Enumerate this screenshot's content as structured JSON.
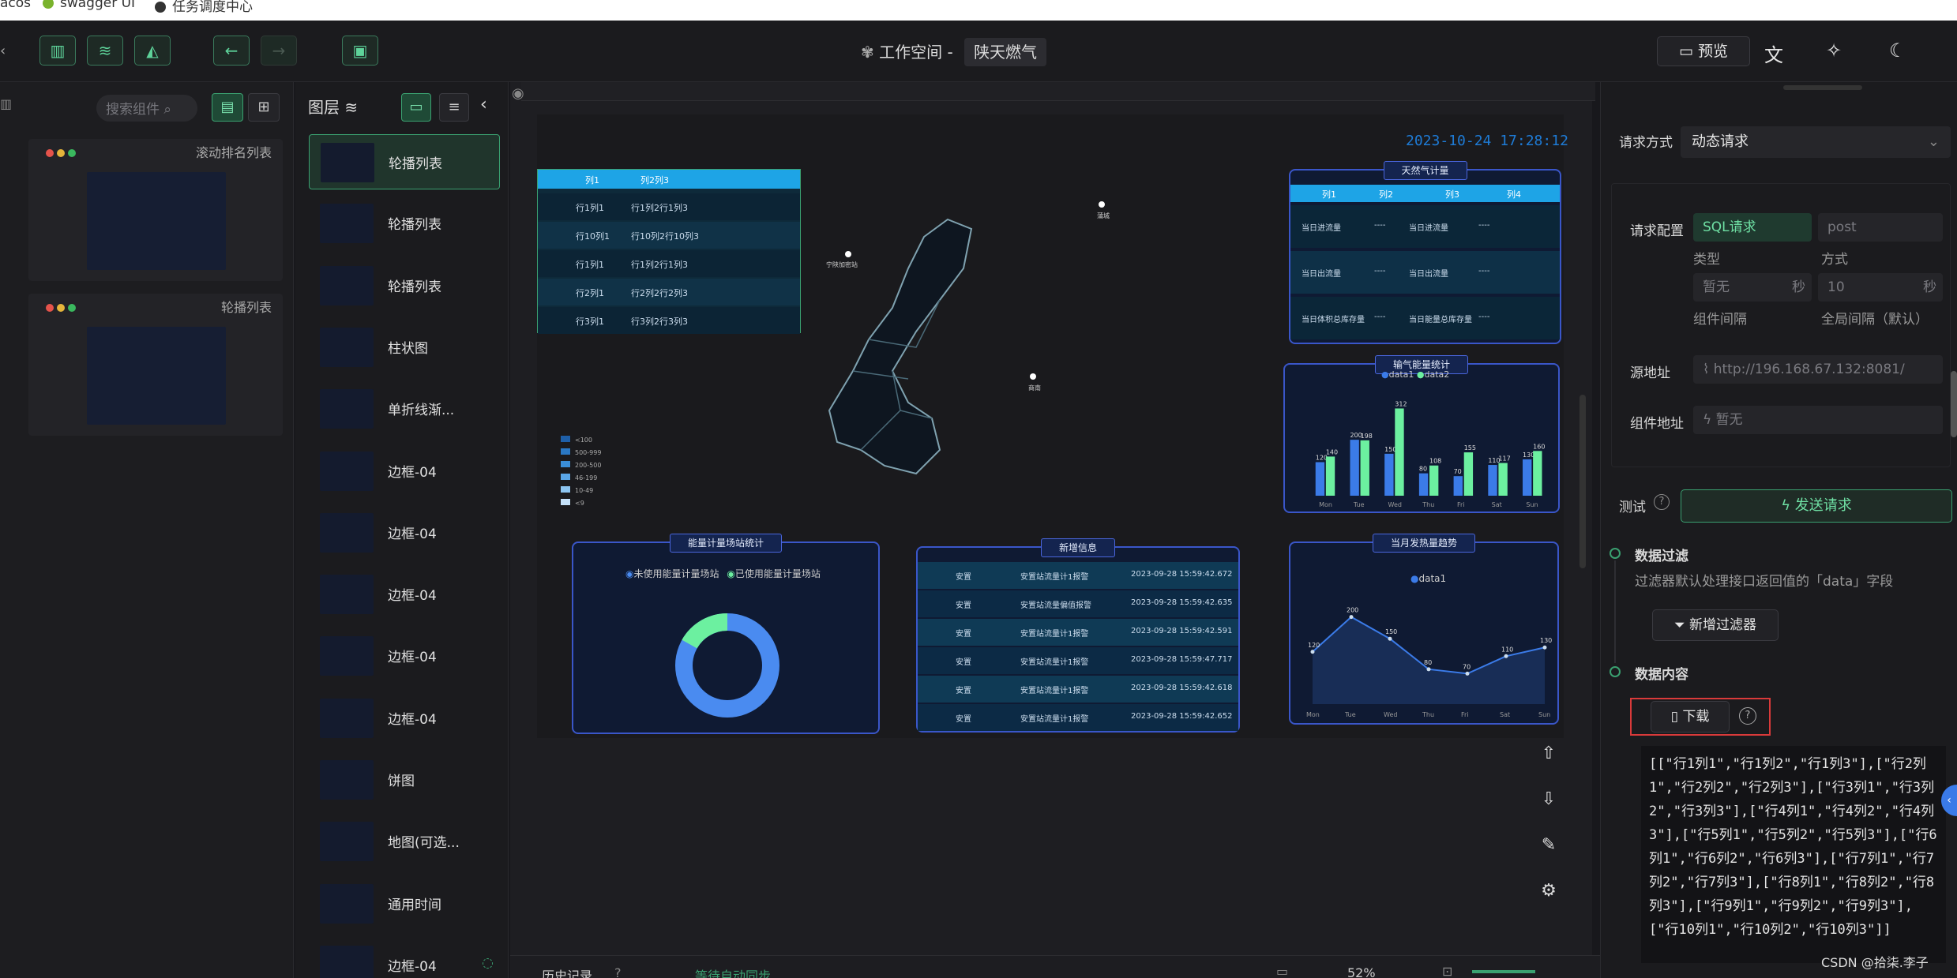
{
  "bookmarks": [
    "acos",
    "swagger UI",
    "任务调度中心"
  ],
  "topbar": {
    "workspace_label": "工作空间 -",
    "project_name": "陕天燃气",
    "preview_label": "预览"
  },
  "components": {
    "search_placeholder": "搜索组件",
    "cards": [
      "滚动排名列表",
      "轮播列表"
    ]
  },
  "layers": {
    "title": "图层",
    "items": [
      "轮播列表",
      "轮播列表",
      "轮播列表",
      "柱状图",
      "单折线渐...",
      "边框-04",
      "边框-04",
      "边框-04",
      "边框-04",
      "边框-04",
      "饼图",
      "地图(可选...",
      "通用时间",
      "边框-04"
    ]
  },
  "canvas": {
    "datetime": "2023-10-24 17:28:12",
    "carousel_table": {
      "headers": [
        "列1",
        "列2列3"
      ],
      "rows": [
        [
          "行1列1",
          "行1列2行1列3"
        ],
        [
          "行10列1",
          "行10列2行10列3"
        ],
        [
          "行1列1",
          "行1列2行1列3"
        ],
        [
          "行2列1",
          "行2列2行2列3"
        ],
        [
          "行3列1",
          "行3列2行3列3"
        ]
      ]
    },
    "gas_panel": {
      "title": "天然气计量",
      "headers": [
        "列1",
        "列2",
        "列3",
        "列4"
      ],
      "rows": [
        [
          "当日进流量",
          "----",
          "当日进流量",
          "----"
        ],
        [
          "当日出流量",
          "----",
          "当日出流量",
          "----"
        ],
        [
          "当日体积总库存量",
          "----",
          "当日能量总库存量",
          "----"
        ]
      ]
    },
    "bar_panel": {
      "title": "输气能量统计",
      "legend": [
        "data1",
        "data2"
      ]
    },
    "pie_panel": {
      "title": "能量计量场站统计",
      "legend": [
        "未使用能量计量场站",
        "已使用能量计量场站"
      ]
    },
    "news_panel": {
      "title": "新增信息",
      "rows": [
        [
          "安置",
          "安置站流量计1报警",
          "2023-09-28 15:59:42.672"
        ],
        [
          "安置",
          "安置站流量偏值报警",
          "2023-09-28 15:59:42.635"
        ],
        [
          "安置",
          "安置站流量计1报警",
          "2023-09-28 15:59:42.591"
        ],
        [
          "安置",
          "安置站流量计1报警",
          "2023-09-28 15:59:47.717"
        ],
        [
          "安置",
          "安置站流量计1报警",
          "2023-09-28 15:59:42.618"
        ],
        [
          "安置",
          "安置站流量计1报警",
          "2023-09-28 15:59:42.652"
        ]
      ]
    },
    "line_panel": {
      "title": "当月发热量趋势",
      "legend": [
        "data1"
      ]
    },
    "map_legend": [
      "<100",
      "500-999",
      "200-500",
      "46-199",
      "10-49",
      "<9"
    ],
    "map_points": [
      "宁陕加密站",
      "蒲城",
      "商南"
    ]
  },
  "chart_data": [
    {
      "type": "bar",
      "title": "输气能量统计",
      "categories": [
        "Mon",
        "Tue",
        "Wed",
        "Thu",
        "Fri",
        "Sat",
        "Sun"
      ],
      "series": [
        {
          "name": "data1",
          "values": [
            120,
            200,
            150,
            80,
            70,
            110,
            130
          ]
        },
        {
          "name": "data2",
          "values": [
            140,
            198,
            312,
            108,
            155,
            117,
            160
          ]
        }
      ],
      "ylim": [
        0,
        350
      ]
    },
    {
      "type": "line",
      "title": "当月发热量趋势",
      "categories": [
        "Mon",
        "Tue",
        "Wed",
        "Thu",
        "Fri",
        "Sat",
        "Sun"
      ],
      "series": [
        {
          "name": "data1",
          "values": [
            120,
            200,
            150,
            80,
            70,
            110,
            130
          ]
        }
      ],
      "ylim": [
        0,
        250
      ]
    }
  ],
  "right": {
    "req_method_label": "请求方式",
    "req_method_value": "动态请求",
    "req_config_label": "请求配置",
    "sql_label": "SQL请求",
    "post_label": "post",
    "type_label": "类型",
    "method_label": "方式",
    "interval_placeholder": "暂无",
    "sec_label": "秒",
    "global_value": "10",
    "comp_interval_label": "组件间隔",
    "global_interval_label": "全局间隔（默认）",
    "source_label": "源地址",
    "source_value": "http://196.168.67.132:8081/",
    "comp_addr_label": "组件地址",
    "comp_addr_value": "暂无",
    "test_label": "测试",
    "send_label": "发送请求",
    "filter_title": "数据过滤",
    "filter_desc": "过滤器默认处理接口返回值的「data」字段",
    "add_filter_label": "新增过滤器",
    "content_title": "数据内容",
    "download_label": "下载",
    "json_text": "[[\"行1列1\",\"行1列2\",\"行1列3\"],[\"行2列1\",\"行2列2\",\"行2列3\"],[\"行3列1\",\"行3列2\",\"行3列3\"],[\"行4列1\",\"行4列2\",\"行4列3\"],[\"行5列1\",\"行5列2\",\"行5列3\"],[\"行6列1\",\"行6列2\",\"行6列3\"],[\"行7列1\",\"行7列2\",\"行7列3\"],[\"行8列1\",\"行8列2\",\"行8列3\"],[\"行9列1\",\"行9列2\",\"行9列3\"],[\"行10列1\",\"行10列2\",\"行10列3\"]]"
  },
  "bottom": {
    "history_label": "历史记录",
    "autosync_label": "等待自动同步",
    "zoom": "52%"
  },
  "watermark": "CSDN @拾柒.李子",
  "colors": {
    "accent": "#3aa070",
    "panel_border": "#3a56c9",
    "bar1": "#3b7be8",
    "bar2": "#6cf0a0",
    "danger": "#d93a3a"
  }
}
